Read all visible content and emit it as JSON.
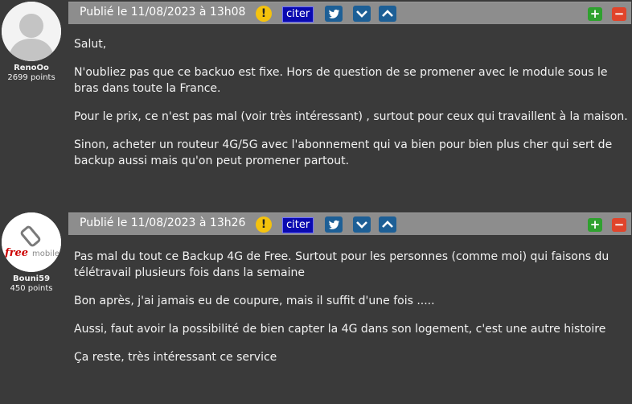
{
  "posts": [
    {
      "author": {
        "name": "RenoOo",
        "points": "2699 points",
        "avatar": "default-user-avatar"
      },
      "header": {
        "published": "Publié le 11/08/2023 à 13h08",
        "warn_symbol": "!",
        "citer": "citer",
        "plus": "+",
        "minus": "−"
      },
      "paragraphs": [
        "Salut,",
        "N'oubliez pas que ce backuo est fixe. Hors de question de se promener avec le module sous le bras dans toute la France.",
        "Pour le prix, ce n'est pas mal (voir très intéressant) , surtout pour ceux qui travaillent à la maison.",
        "Sinon, acheter un routeur 4G/5G avec l'abonnement qui va bien pour bien plus cher qui sert de backup aussi mais qu'on peut promener partout."
      ]
    },
    {
      "author": {
        "name": "Bouni59",
        "points": "450 points",
        "avatar": "free-mobile-logo",
        "logo_text_free": "free",
        "logo_text_mobile": "mobile"
      },
      "header": {
        "published": "Publié le 11/08/2023 à 13h26",
        "warn_symbol": "!",
        "citer": "citer",
        "plus": "+",
        "minus": "−"
      },
      "paragraphs": [
        "Pas mal du tout ce Backup 4G de Free. Surtout pour les personnes (comme moi) qui faisons du télétravail plusieurs fois dans la semaine",
        "Bon après, j'ai jamais eu de coupure, mais il suffit d'une fois .....",
        "Aussi, faut avoir la possibilité de bien capter la 4G dans son logement, c'est une autre histoire",
        "Ça reste, très intéressant ce service"
      ]
    }
  ],
  "colors": {
    "background": "#3a3a3a",
    "header": "#8d8d8d",
    "citer": "#0a0ab0",
    "icon_button": "#1d5f96",
    "plus": "#2fa12f",
    "minus": "#e0442b",
    "warning": "#f4c20d"
  }
}
